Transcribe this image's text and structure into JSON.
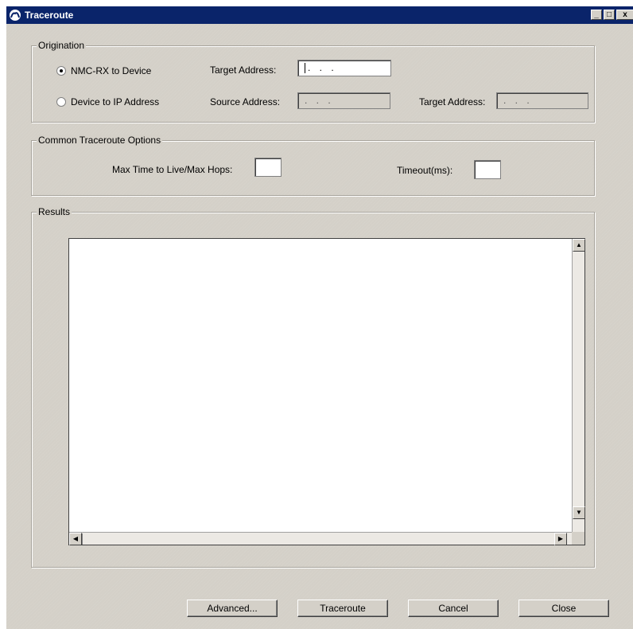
{
  "window": {
    "title": "Traceroute",
    "controls": {
      "minimize": "_",
      "maximize": "□",
      "close": "x"
    }
  },
  "origination": {
    "legend": "Origination",
    "option1": {
      "label": "NMC-RX to Device",
      "selected": true
    },
    "option2": {
      "label": "Device to IP Address",
      "selected": false
    },
    "target_address_label": "Target Address:",
    "target_address_value": ". . .",
    "source_address_label": "Source Address:",
    "source_address_value": ". . .",
    "target_address2_label": "Target Address:",
    "target_address2_value": ". . ."
  },
  "options": {
    "legend": "Common Traceroute Options",
    "max_ttl_label": "Max Time to Live/Max Hops:",
    "max_ttl_value": "",
    "timeout_label": "Timeout(ms):",
    "timeout_value": ""
  },
  "results": {
    "legend": "Results",
    "text": ""
  },
  "buttons": {
    "advanced": "Advanced...",
    "traceroute": "Traceroute",
    "cancel": "Cancel",
    "close": "Close"
  },
  "colors": {
    "titlebar": "#0a246a",
    "dialog_bg": "#d4d0c8"
  }
}
